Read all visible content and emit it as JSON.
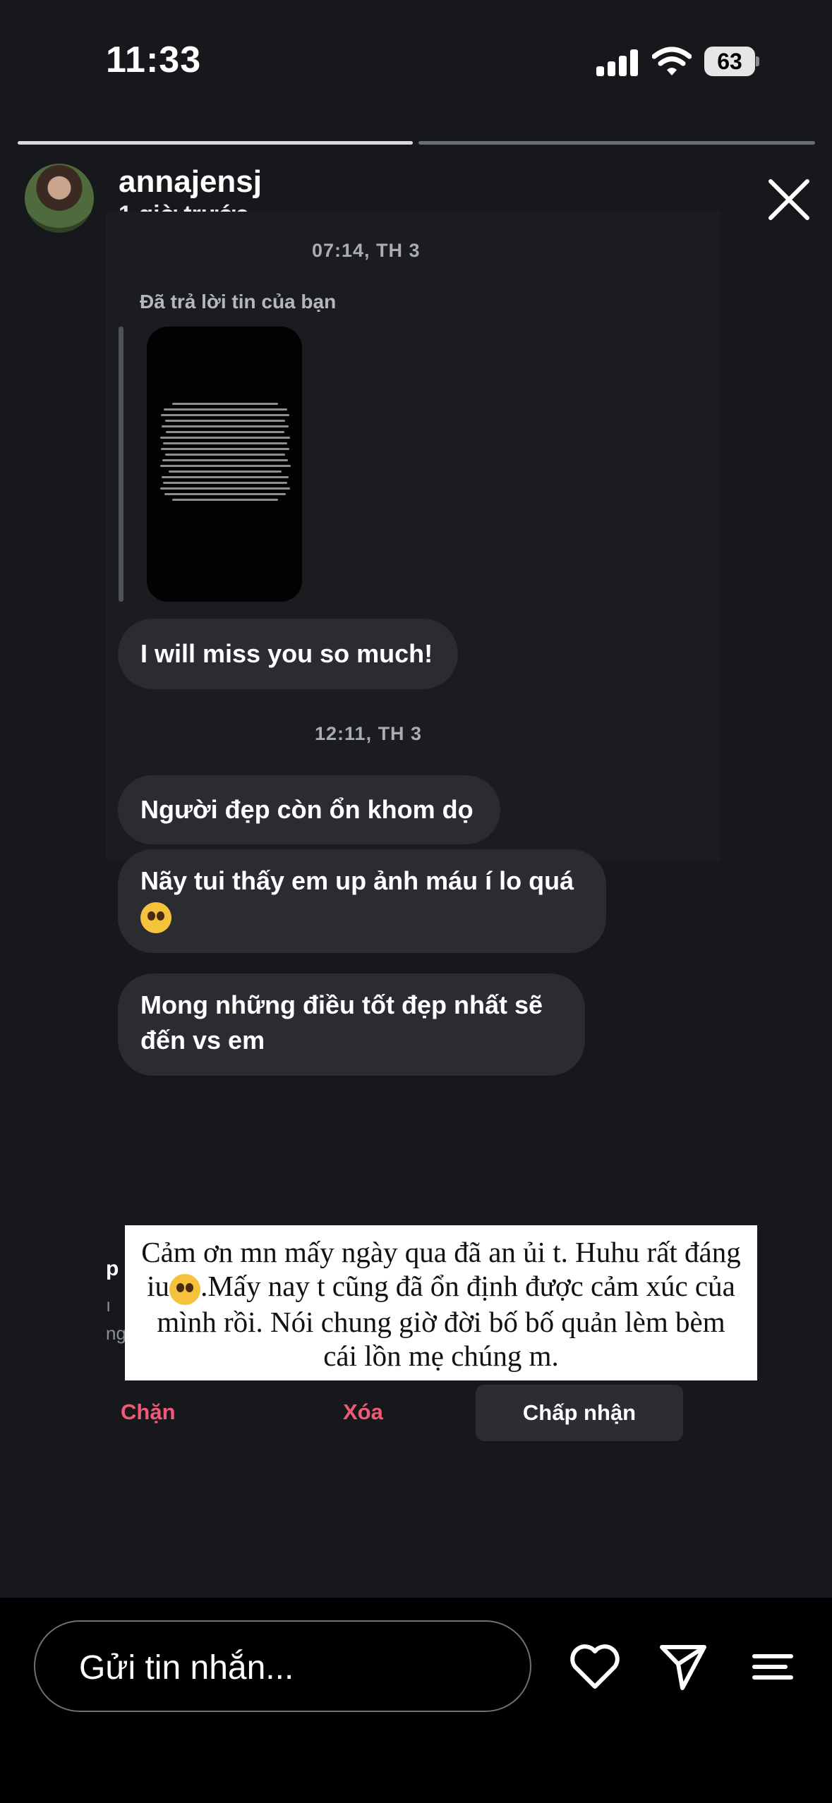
{
  "status_bar": {
    "time": "11:33",
    "battery": "63"
  },
  "story": {
    "username": "annajensj",
    "posted": "1 giờ trước",
    "icons": [
      "avatar",
      "close-icon"
    ]
  },
  "conversation": {
    "timestamp_1": "07:14, TH 3",
    "replied_label": "Đã trả lời tin của bạn",
    "message_1": "I will miss you so much!",
    "timestamp_2": "12:11, TH 3",
    "message_2": "Người đẹp còn ổn khom dọ",
    "message_3": "Nãy tui thấy em up ảnh máu í lo quá",
    "message_4_line_1": "Mong những điều tốt đẹp nhất sẽ",
    "message_4_line_2": "đến vs em",
    "partial_letter": "p",
    "partial_line_1": "ı",
    "partial_line_2": "ng"
  },
  "caption": {
    "text_1": "Cảm ơn mn mấy ngày qua đã an ủi t. Huhu rất đáng iu",
    "text_2": ".Mấy nay t cũng đã ổn định được cảm xúc của mình rồi. Nói chung giờ đời bố bố quản lèm bèm cái lồn mẹ chúng m."
  },
  "actions": {
    "block": "Chặn",
    "delete": "Xóa",
    "accept": "Chấp nhận"
  },
  "reply_bar": {
    "placeholder": "Gửi tin nhắn...",
    "icons": [
      "heart-icon",
      "send-icon",
      "menu-icon"
    ]
  },
  "colors": {
    "background": "#16181c",
    "bubble": "#2a2c31",
    "danger": "#ee5a77",
    "progress_active": "#d9d9d9"
  }
}
